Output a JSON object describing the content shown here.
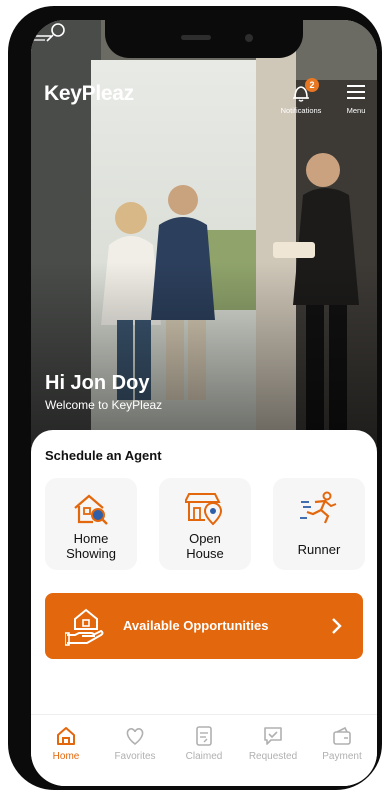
{
  "header": {
    "logo_text": "KeyPleaz",
    "notifications_label": "Notifications",
    "notifications_count": "2",
    "menu_label": "Menu"
  },
  "greeting": {
    "title": "Hi Jon Doy",
    "subtitle": "Welcome to KeyPleaz"
  },
  "schedule": {
    "title": "Schedule an Agent",
    "tiles": [
      {
        "label_line1": "Home",
        "label_line2": "Showing",
        "icon": "house-search-icon"
      },
      {
        "label_line1": "Open",
        "label_line2": "House",
        "icon": "open-house-location-icon"
      },
      {
        "label_line1": "Runner",
        "label_line2": "",
        "icon": "runner-icon"
      }
    ]
  },
  "cta": {
    "label": "Available Opportunities",
    "icon": "hand-house-icon"
  },
  "tabs": [
    {
      "label": "Home",
      "icon": "home-icon",
      "active": true
    },
    {
      "label": "Favorites",
      "icon": "heart-icon",
      "active": false
    },
    {
      "label": "Claimed",
      "icon": "clipboard-icon",
      "active": false
    },
    {
      "label": "Requested",
      "icon": "check-chat-icon",
      "active": false
    },
    {
      "label": "Payment",
      "icon": "wallet-icon",
      "active": false
    }
  ],
  "colors": {
    "accent": "#e3670c",
    "badge": "#e87722",
    "inactive_tab": "#b0b0b0"
  }
}
